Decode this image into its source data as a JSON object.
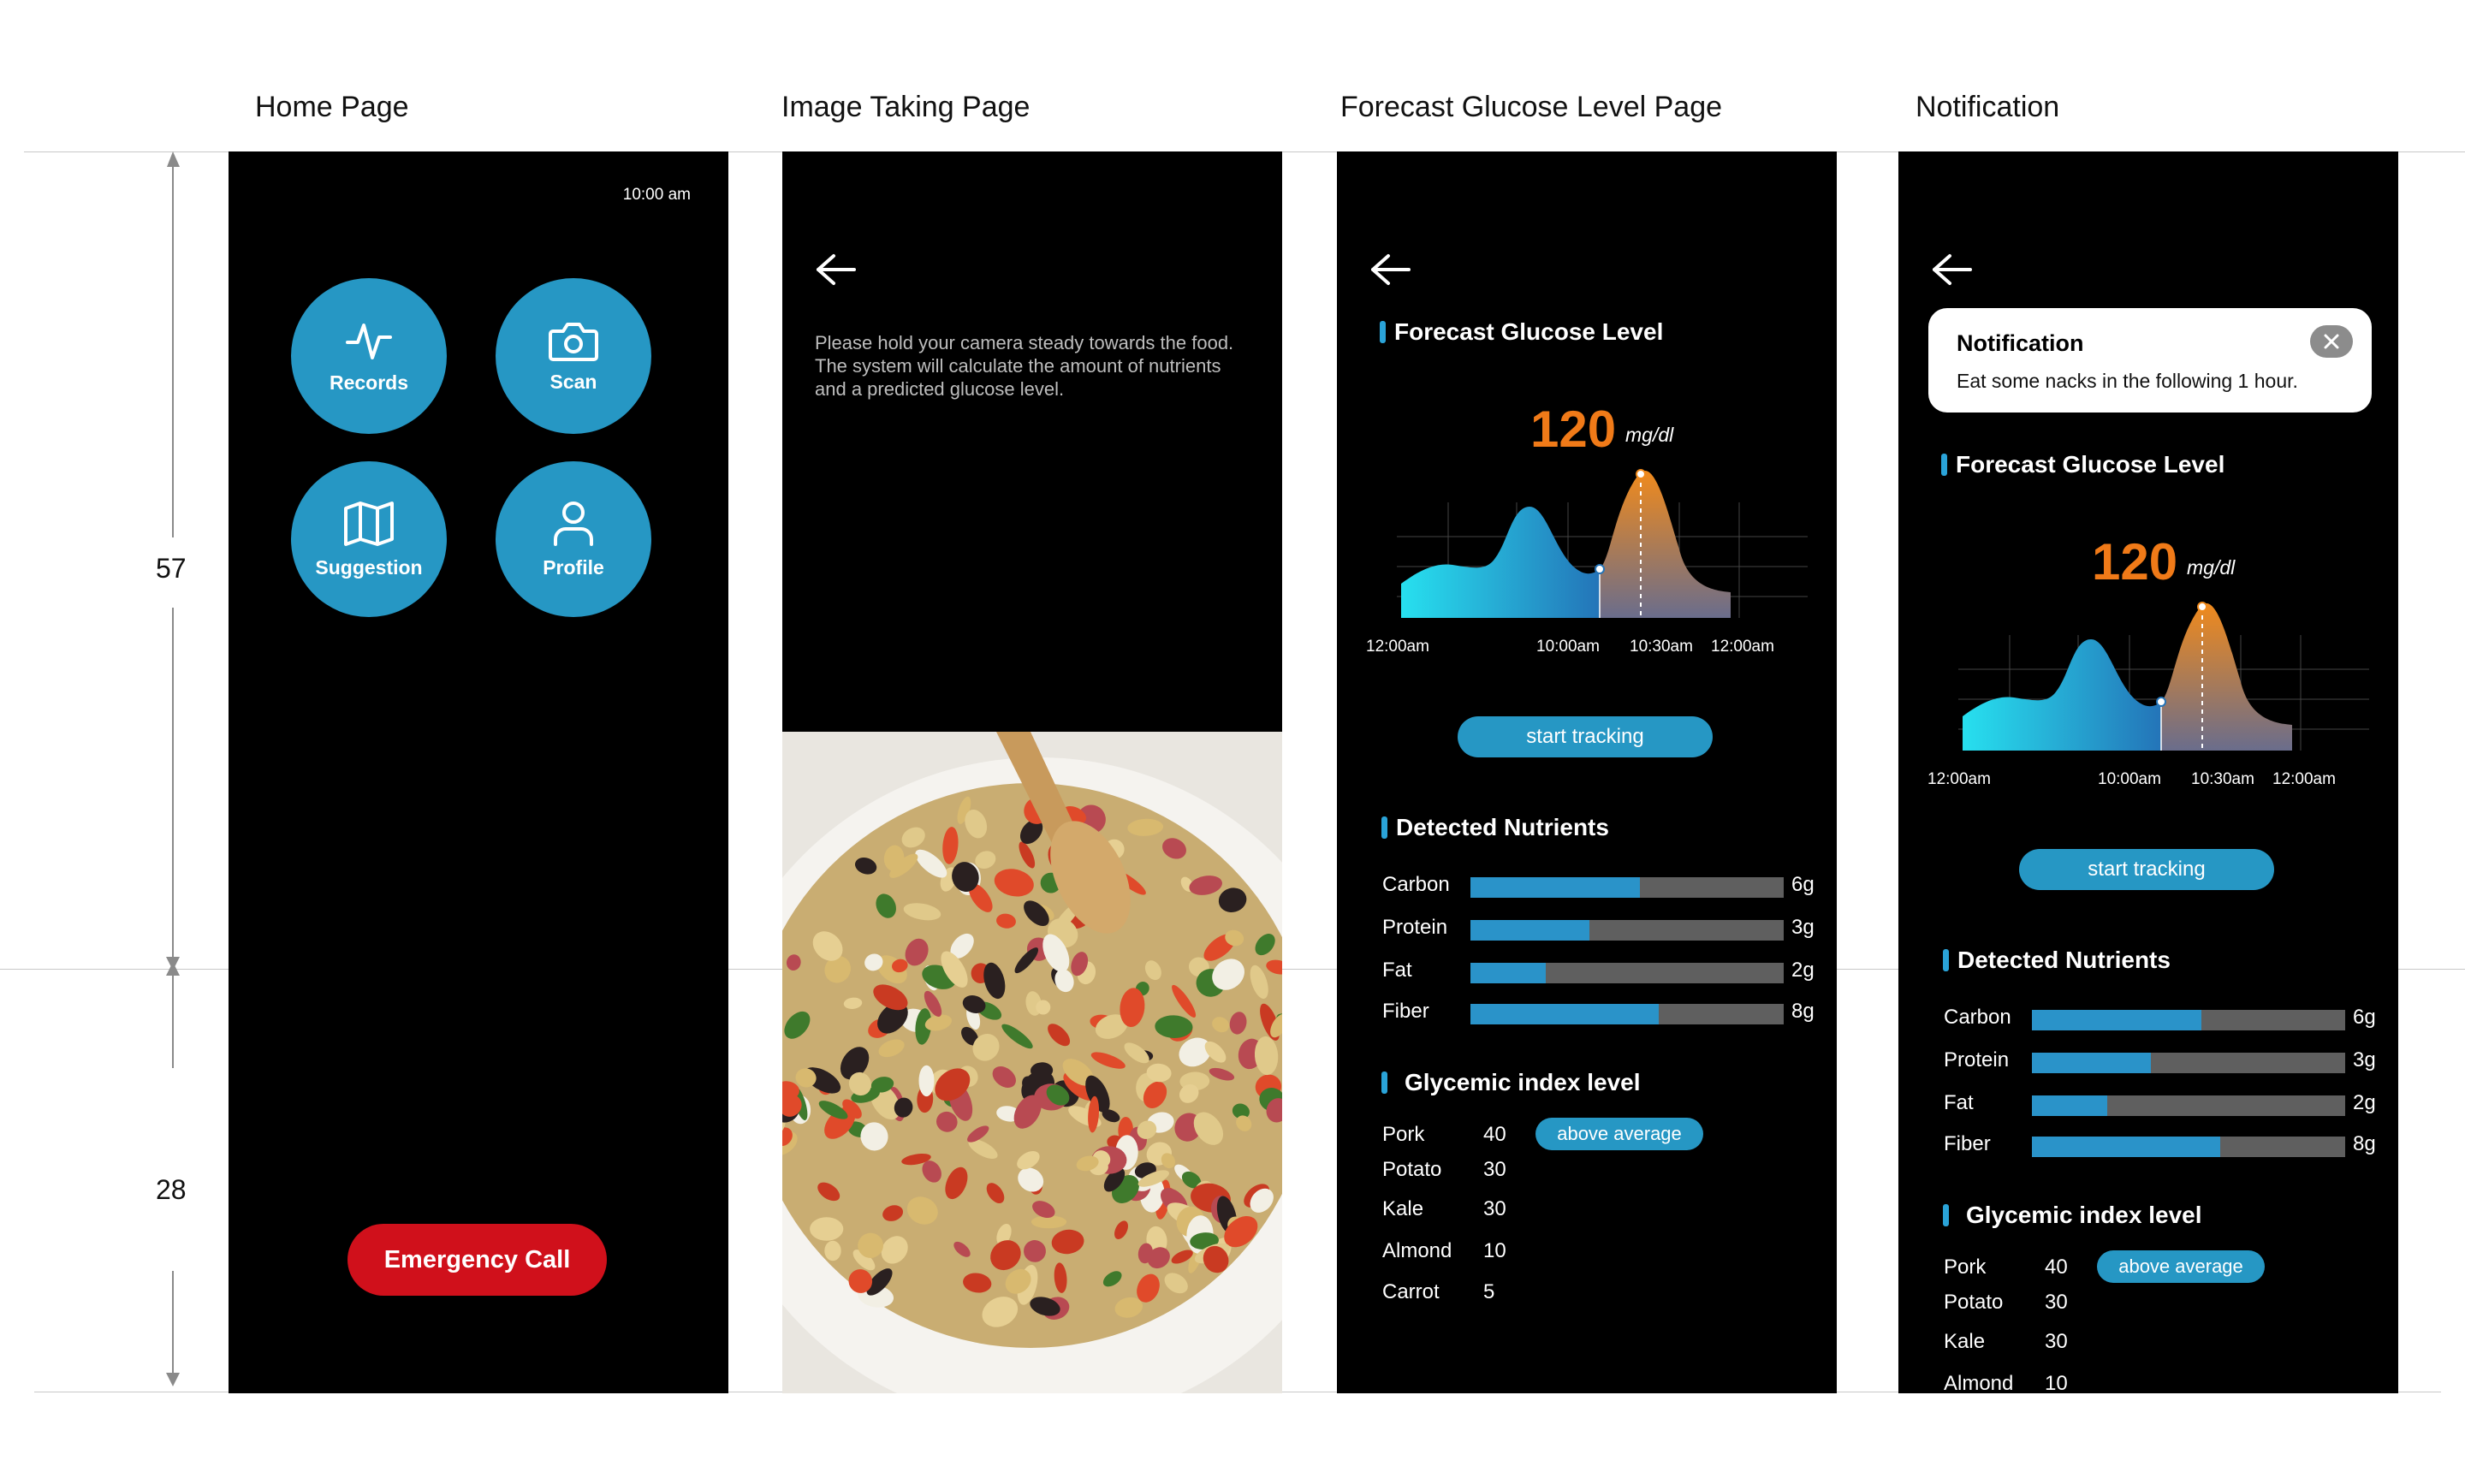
{
  "titles": {
    "home": "Home Page",
    "image": "Image Taking Page",
    "forecast": "Forecast Glucose Level Page",
    "notification": "Notification"
  },
  "dimensions": {
    "upper": "57",
    "lower": "28"
  },
  "home": {
    "time": "10:00 am",
    "buttons": [
      "Records",
      "Scan",
      "Suggestion",
      "Profile"
    ],
    "emergency": "Emergency Call"
  },
  "image_page": {
    "instruction": "Please hold your camera steady towards the food. The system will calculate the amount of nutrients and a predicted glucose level."
  },
  "forecast": {
    "section_title": "Forecast Glucose Level",
    "glucose_value": "120",
    "glucose_unit": "mg/dl",
    "x_labels": [
      "12:00am",
      "10:00am",
      "10:30am",
      "12:00am"
    ],
    "start_tracking": "start tracking",
    "nutrients_title": "Detected Nutrients",
    "nutrients": [
      {
        "name": "Carbon",
        "value": "6g",
        "fraction": 0.54
      },
      {
        "name": "Protein",
        "value": "3g",
        "fraction": 0.38
      },
      {
        "name": "Fat",
        "value": "2g",
        "fraction": 0.24
      },
      {
        "name": "Fiber",
        "value": "8g",
        "fraction": 0.6
      }
    ],
    "gi_title": "Glycemic index level",
    "gi_badge": "above average",
    "gi_items": [
      {
        "name": "Pork",
        "value": "40"
      },
      {
        "name": "Potato",
        "value": "30"
      },
      {
        "name": "Kale",
        "value": "30"
      },
      {
        "name": "Almond",
        "value": "10"
      },
      {
        "name": "Carrot",
        "value": "5"
      }
    ]
  },
  "notification": {
    "title": "Notification",
    "message": "Eat some nacks in the following 1 hour."
  },
  "colors": {
    "accent": "#2697c4",
    "emergency": "#d0101b",
    "glucose": "#f07a18"
  }
}
